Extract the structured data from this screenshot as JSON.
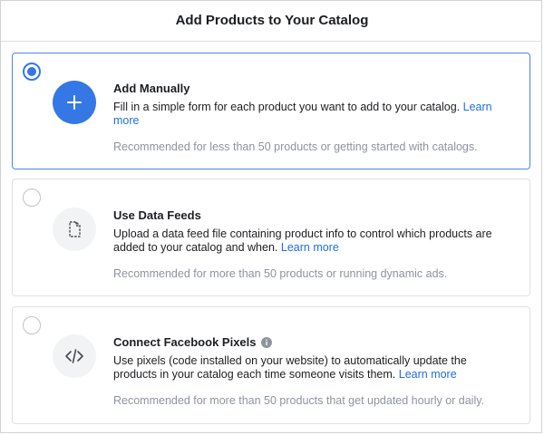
{
  "dialog": {
    "title": "Add Products to Your Catalog"
  },
  "options": [
    {
      "name": "Add Manually",
      "description": "Fill in a simple form for each product you want to add to your catalog.",
      "link": "Learn more",
      "note": "Recommended for less than 50 products or getting started with catalogs.",
      "selected": true,
      "icon": "plus-icon"
    },
    {
      "name": "Use Data Feeds",
      "description": "Upload a data feed file containing product info to control which products are added to your catalog and when.",
      "link": "Learn more",
      "note": "Recommended for more than 50 products or running dynamic ads.",
      "selected": false,
      "icon": "document-icon"
    },
    {
      "name": "Connect Facebook Pixels",
      "description": "Use pixels (code installed on your website) to automatically update the products in your catalog each time someone visits them.",
      "link": "Learn more",
      "note": "Recommended for more than 50 products that get updated hourly or daily.",
      "selected": false,
      "icon": "code-icon",
      "info_icon": "info-icon"
    }
  ],
  "colors": {
    "accent": "#3578e5",
    "link": "#216fdb",
    "muted": "#8d949e"
  }
}
